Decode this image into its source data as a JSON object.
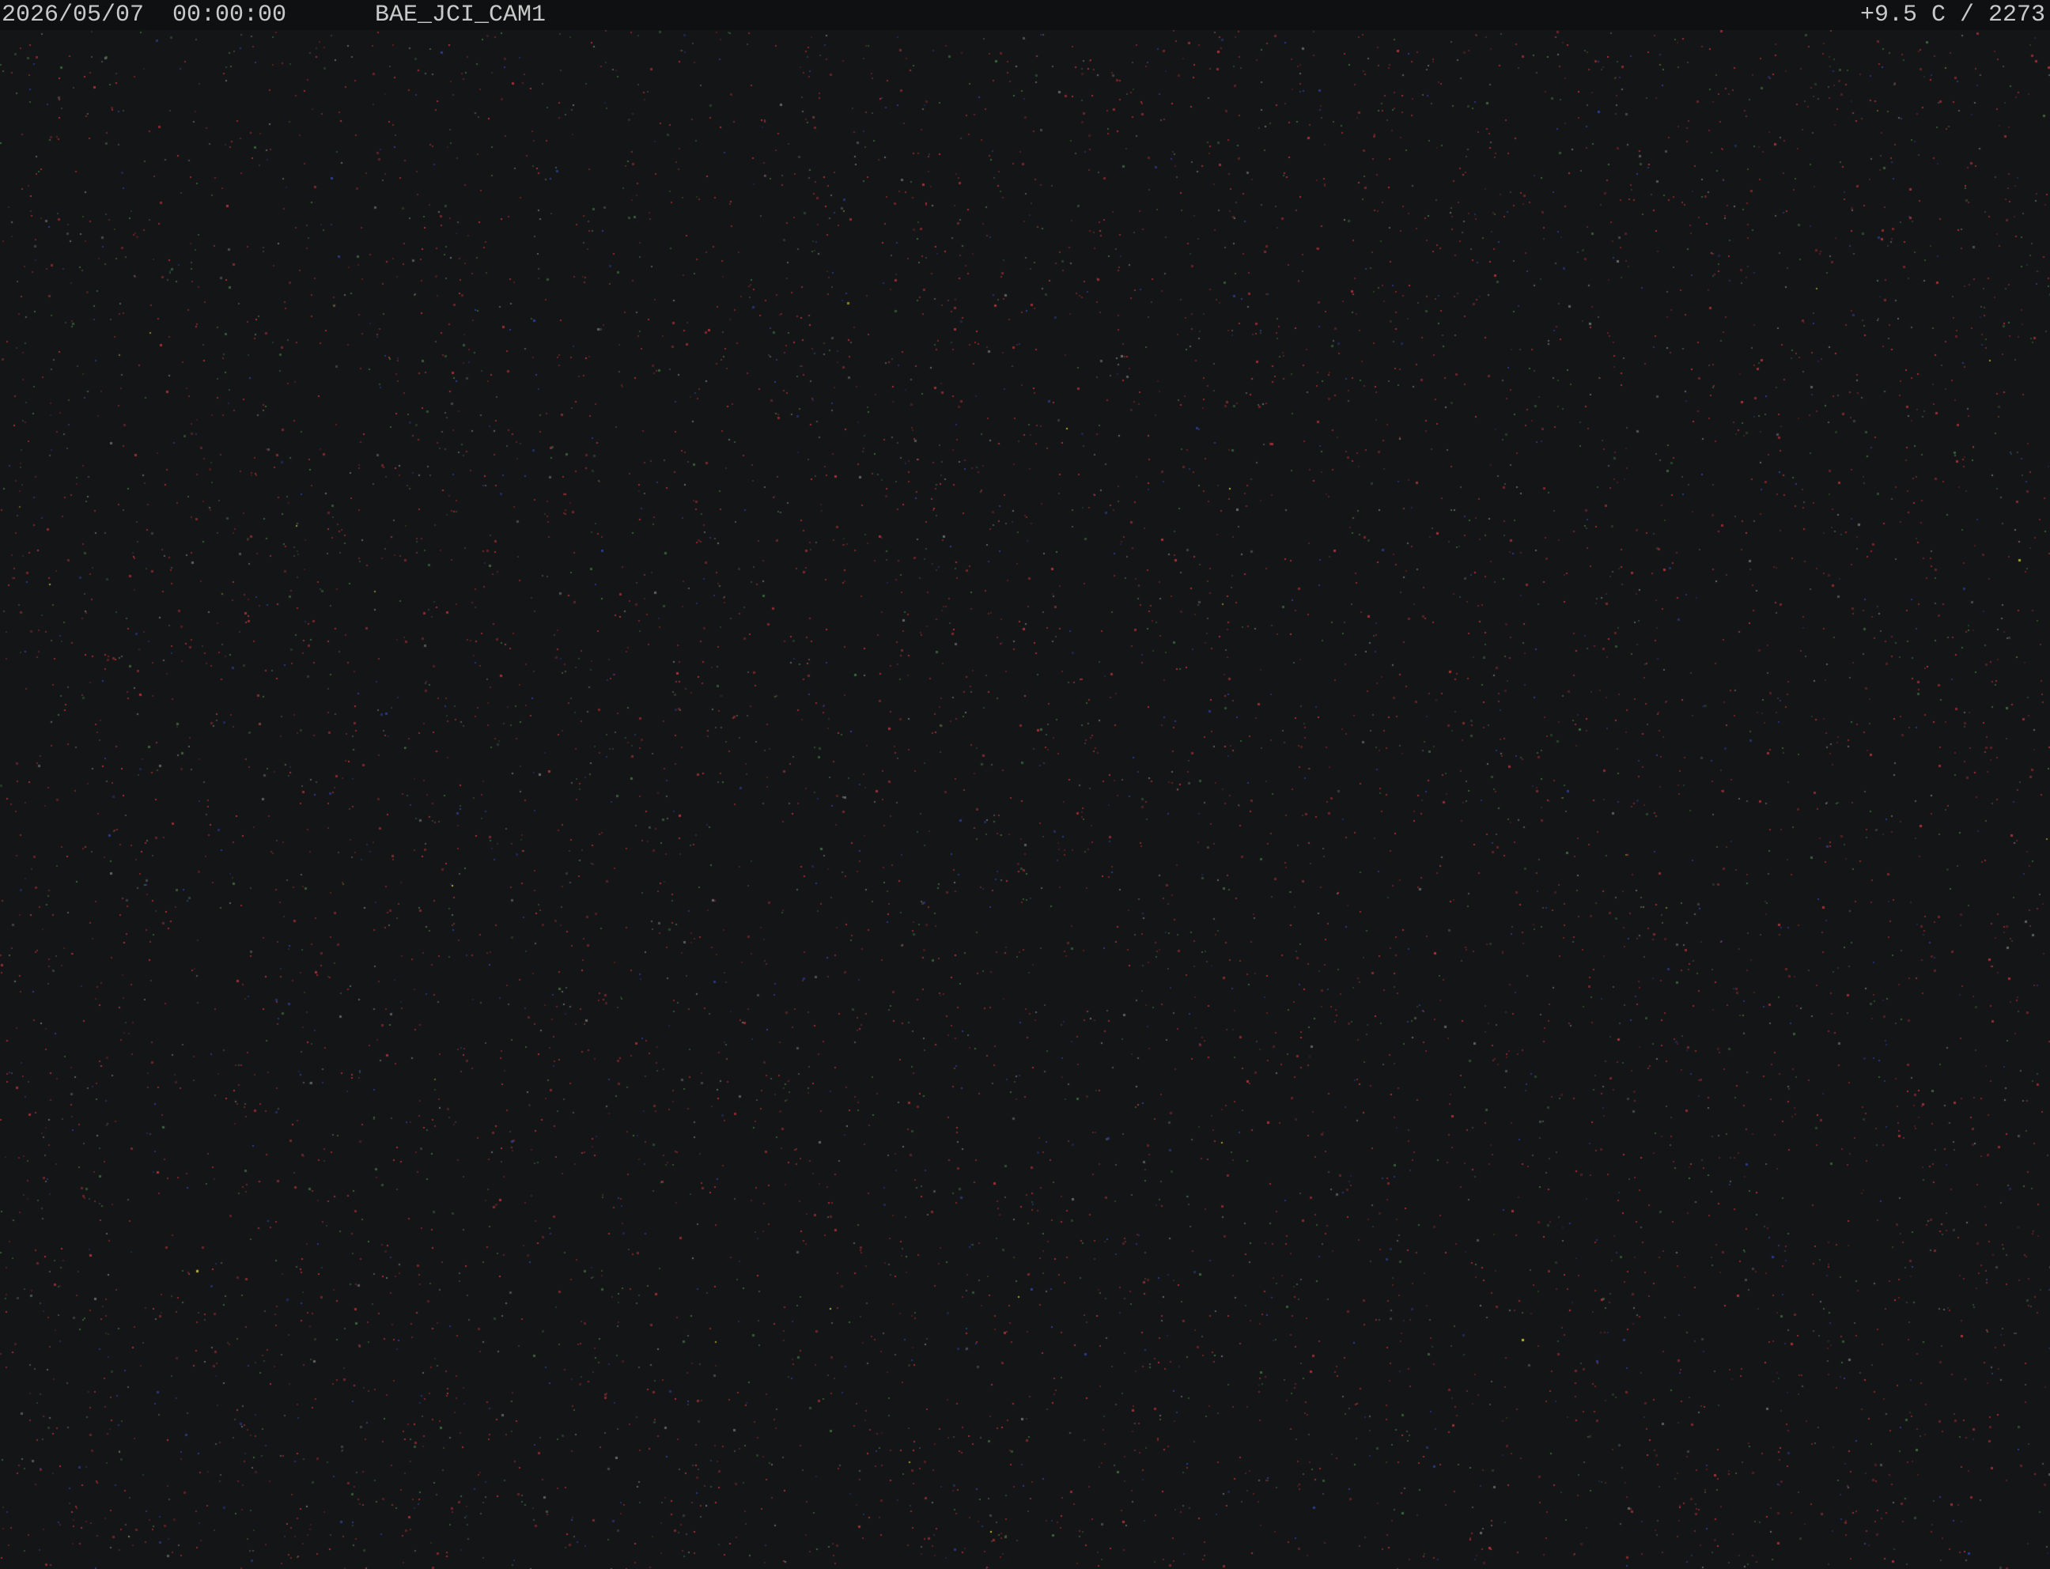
{
  "overlay": {
    "datetime": "2026/05/07  00:00:00",
    "camera_name": "BAE_JCI_CAM1",
    "sensor_readout": "+9.5 C / 2273"
  },
  "colors": {
    "background": "#141516",
    "overlay_bar": "#0f1011",
    "overlay_text": "#c9c9c9",
    "noise_colors": [
      "#b3313b",
      "#8a2a32",
      "#3d6b3f",
      "#2e3f9a",
      "#6e6e6e",
      "#c8c038"
    ]
  }
}
